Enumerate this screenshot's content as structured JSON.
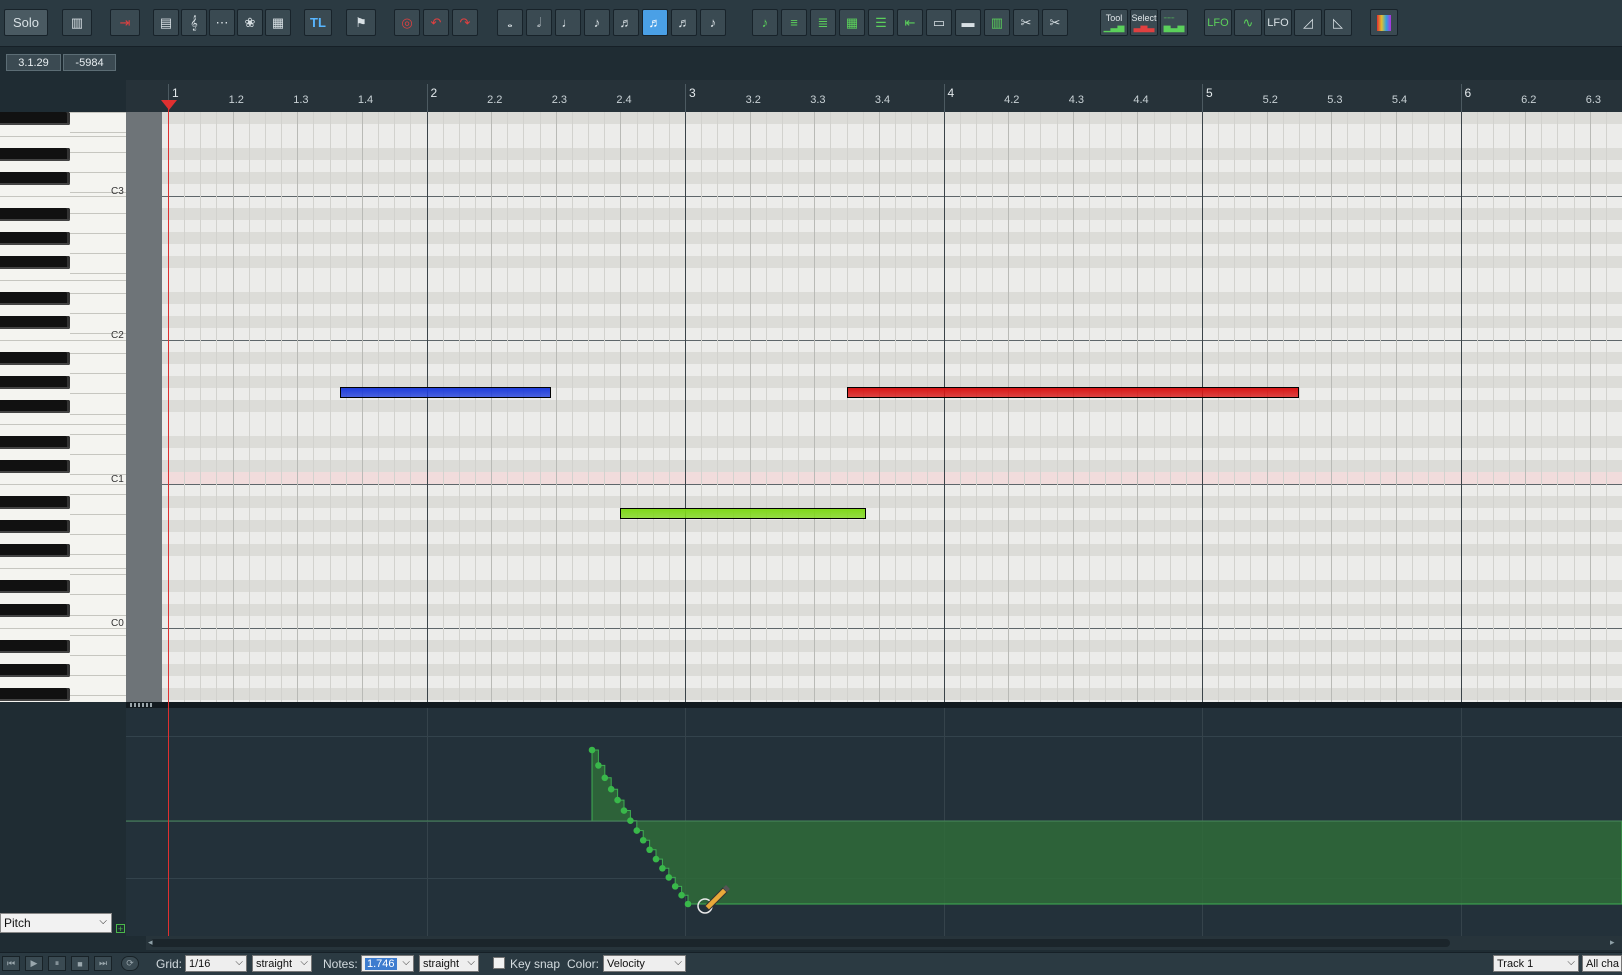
{
  "toolbar": {
    "solo_label": "Solo",
    "tl_label": "TL",
    "tool_label": "Tool",
    "select_label": "Select",
    "lfo_label": "LFO",
    "lfo2_label": "LFO"
  },
  "position": {
    "time": "3.1.29",
    "value": "-5984"
  },
  "ruler": {
    "labels": [
      "1",
      "1.2",
      "1.3",
      "1.4",
      "2",
      "2.2",
      "2.3",
      "2.4",
      "3",
      "3.2",
      "3.3",
      "3.4",
      "4",
      "4.2",
      "4.3",
      "4.4",
      "5",
      "5.2",
      "5.3",
      "5.4",
      "6",
      "6.2",
      "6.3"
    ]
  },
  "piano": {
    "octaves": [
      "C3",
      "C2",
      "C1",
      "C0"
    ]
  },
  "notes": [
    {
      "name": "note-blue",
      "color": "#1f3ddb"
    },
    {
      "name": "note-green",
      "color": "#7fd81a"
    },
    {
      "name": "note-red",
      "color": "#d81616"
    }
  ],
  "lane": {
    "controller": "Pitch"
  },
  "bottom": {
    "grid_label": "Grid:",
    "grid_value": "1/16",
    "grid_mode": "straight",
    "notes_label": "Notes:",
    "notes_value": "1.746",
    "notes_mode": "straight",
    "keysnap_label": "Key snap",
    "color_label": "Color:",
    "color_value": "Velocity",
    "track_value": "Track 1",
    "channel_value": "All cha"
  },
  "colors": {
    "playhead": "#e03030",
    "cc_fill": "#2f6b3a",
    "cc_point": "#39b84a"
  }
}
